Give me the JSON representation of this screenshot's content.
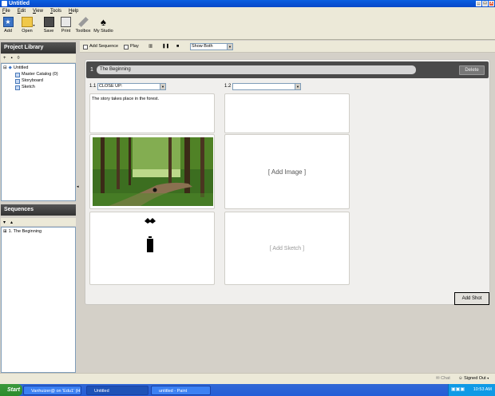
{
  "window": {
    "title": "Untitled",
    "min": "_",
    "max": "□",
    "close": "x"
  },
  "menu": [
    "File",
    "Edit",
    "View",
    "Tools",
    "Help"
  ],
  "toolbar": {
    "add": "Add",
    "open": "Open",
    "save": "Save",
    "print": "Print",
    "toolbox": "Toolbox",
    "my_studio": "My Studio"
  },
  "project_library": {
    "title": "Project Library",
    "tools": [
      "+",
      "▪",
      "◊"
    ],
    "tree": {
      "root": "Untitled",
      "items": [
        "Master Catalog (0)",
        "Storyboard",
        "Sketch"
      ]
    }
  },
  "sequences_panel": {
    "title": "Sequences",
    "tools": [
      "▾",
      "▴"
    ],
    "items": [
      "1. The Beginning"
    ]
  },
  "main_toolbar": {
    "add_sequence": "Add Sequence",
    "play": "Play",
    "show_select": "Show Both"
  },
  "sequence": {
    "number": "1",
    "title": "The Beginning",
    "delete_label": "Delete"
  },
  "shots": [
    {
      "label": "1.1",
      "shot_type": "CLOSE UP:",
      "description": "The story takes place in the forest.",
      "image_label": "",
      "sketch_label": ""
    },
    {
      "label": "1.2",
      "shot_type": "",
      "description": "",
      "image_label": "[ Add Image ]",
      "sketch_label": "[ Add Sketch ]"
    }
  ],
  "add_shot_label": "Add Shot",
  "status": {
    "chat": "Chat",
    "signed_out": "Signed Out"
  },
  "taskbar": {
    "start": "Start",
    "tasks": [
      "Vanhuizer@ on 'Edu1' (H:)",
      "Untitled",
      "untitled - Paint"
    ],
    "clock": "10:53 AM"
  },
  "colors": {
    "title_bar": "#0a5fe0",
    "panel_header": "#444444",
    "sequence_bar": "#4a4a4a",
    "taskbar": "#245dd7",
    "start": "#2b8a2b"
  }
}
